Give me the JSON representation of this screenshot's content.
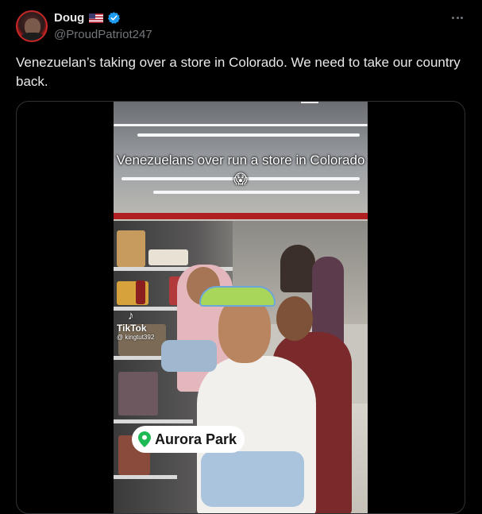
{
  "author": {
    "display_name": "Doug",
    "flag_emoji": "🇺🇸",
    "handle": "@ProudPatriot247",
    "verified": true
  },
  "menu": {
    "icon": "more-horizontal-icon"
  },
  "tweet": {
    "text": "Venezuelan’s taking over a store in Colorado. We need to take our country back."
  },
  "video": {
    "overlay_title": "Venezuelans over run a store in Colorado 😱",
    "tiktok_brand": "TikTok",
    "tiktok_user": "@ kingtut392",
    "location": "Aurora Park"
  },
  "colors": {
    "background": "#000000",
    "text_primary": "#e7e9ea",
    "text_secondary": "#71767b",
    "verified_blue": "#1d9bf0",
    "border": "#2f3336",
    "pin_green": "#1db954"
  }
}
